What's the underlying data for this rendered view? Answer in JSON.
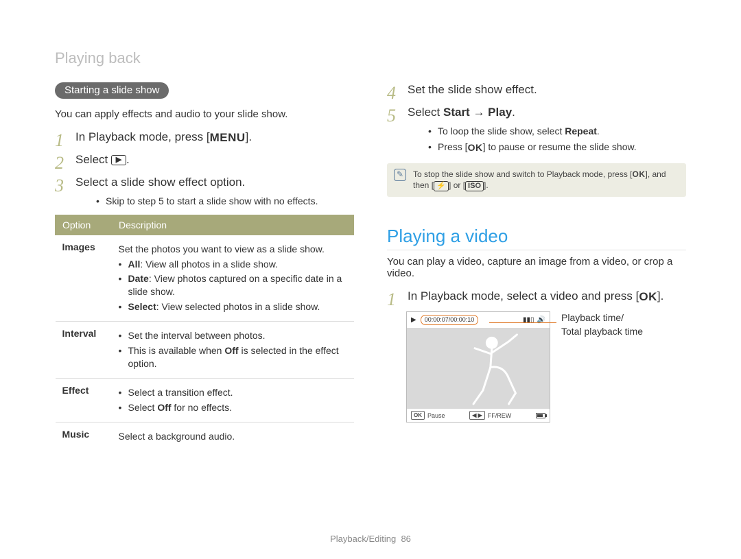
{
  "header": "Playing back",
  "left": {
    "pill": "Starting a slide show",
    "lead": "You can apply effects and audio to your slide show.",
    "steps": {
      "s1_pre": "In Playback mode, press [",
      "s1_icon": "MENU",
      "s1_post": "].",
      "s2_pre": "Select ",
      "s2_icon": "▶",
      "s2_post": ".",
      "s3": "Select a slide show effect option.",
      "s3_sub": "Skip to step 5 to start a slide show with no effects."
    },
    "table": {
      "h_option": "Option",
      "h_desc": "Description",
      "rows": [
        {
          "name": "Images",
          "lead": "Set the photos you want to view as a slide show.",
          "items": [
            {
              "b": "All",
              "rest": ": View all photos in a slide show."
            },
            {
              "b": "Date",
              "rest": ": View photos captured on a specific date in a slide show."
            },
            {
              "b": "Select",
              "rest": ": View selected photos in a slide show."
            }
          ]
        },
        {
          "name": "Interval",
          "items": [
            {
              "rest": "Set the interval between photos."
            },
            {
              "rest_pre": "This is available when ",
              "b": "Off",
              "rest": " is selected in the effect option."
            }
          ]
        },
        {
          "name": "Effect",
          "items": [
            {
              "rest": "Select a transition effect."
            },
            {
              "rest_pre": "Select ",
              "b": "Off",
              "rest": " for no effects."
            }
          ]
        },
        {
          "name": "Music",
          "plain": "Select a background audio."
        }
      ]
    }
  },
  "right": {
    "s4": "Set the slide show effect.",
    "s5_pre": "Select ",
    "s5_b1": "Start",
    "s5_arrow": " → ",
    "s5_b2": "Play",
    "s5_post": ".",
    "s5_sub1_pre": "To loop the slide show, select ",
    "s5_sub1_b": "Repeat",
    "s5_sub1_post": ".",
    "s5_sub2_pre": "Press [",
    "s5_sub2_icon": "OK",
    "s5_sub2_post": "] to pause or resume the slide show.",
    "note_pre": "To stop the slide show and switch to Playback mode, press [",
    "note_icon1": "OK",
    "note_mid": "], and then [",
    "note_icon2": "⚡",
    "note_or": "] or [",
    "note_icon3": "ISO",
    "note_post": "].",
    "section_title": "Playing a video",
    "section_lead": "You can play a video, capture an image from a video, or crop a video.",
    "vs1_pre": "In Playback mode, select a video and press [",
    "vs1_icon": "OK",
    "vs1_post": "].",
    "vid_time": "00:00:07/00:00:10",
    "vid_pause": "Pause",
    "vid_ok": "OK",
    "vid_lr": "◀ ▶",
    "vid_ff": "FF/REW",
    "annot1": "Playback time/",
    "annot2": "Total playback time"
  },
  "footer": {
    "label": "Playback/Editing",
    "page": "86"
  }
}
